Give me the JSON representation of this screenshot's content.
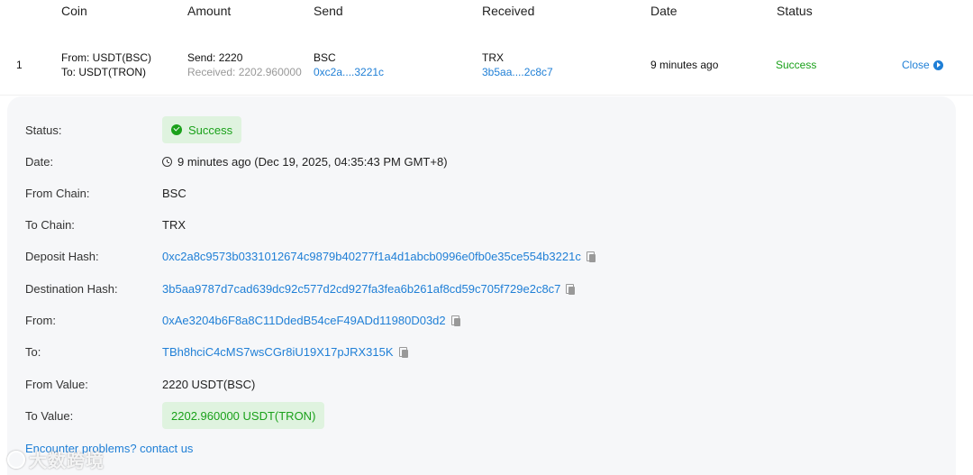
{
  "table": {
    "headers": {
      "coin": "Coin",
      "amount": "Amount",
      "send": "Send",
      "received": "Received",
      "date": "Date",
      "status": "Status"
    },
    "row": {
      "index": "1",
      "from_coin": "From: USDT(BSC)",
      "to_coin": "To: USDT(TRON)",
      "send_amount": "Send: 2220",
      "received_amount": "Received: 2202.960000",
      "send_chain": "BSC",
      "send_hash_short": "0xc2a....3221c",
      "received_chain": "TRX",
      "received_hash_short": "3b5aa....2c8c7",
      "date": "9 minutes ago",
      "status": "Success",
      "close_label": "Close"
    }
  },
  "details": {
    "status_label": "Status:",
    "status_value": "Success",
    "date_label": "Date:",
    "date_value": "9 minutes ago (Dec 19, 2025, 04:35:43 PM GMT+8)",
    "from_chain_label": "From Chain:",
    "from_chain_value": "BSC",
    "to_chain_label": "To Chain:",
    "to_chain_value": "TRX",
    "deposit_hash_label": "Deposit Hash:",
    "deposit_hash_value": "0xc2a8c9573b0331012674c9879b40277f1a4d1abcb0996e0fb0e35ce554b3221c",
    "destination_hash_label": "Destination Hash:",
    "destination_hash_value": "3b5aa9787d7cad639dc92c577d2cd927fa3fea6b261af8cd59c705f729e2c8c7",
    "from_label": "From:",
    "from_value": "0xAe3204b6F8a8C11DdedB54ceF49ADd11980D03d2",
    "to_label": "To:",
    "to_value": "TBh8hciC4cMS7wsCGr8iU19X17pJRX315K",
    "from_value_label": "From Value:",
    "from_value_value": "2220 USDT(BSC)",
    "to_value_label": "To Value:",
    "to_value_value": "2202.960000 USDT(TRON)",
    "problems_link": "Encounter problems? contact us"
  },
  "watermark": "大数跨境",
  "colors": {
    "link": "#1f7fd6",
    "success": "#1aa11a",
    "success_bg": "#dff3df",
    "panel_bg": "#f6f7f9"
  }
}
